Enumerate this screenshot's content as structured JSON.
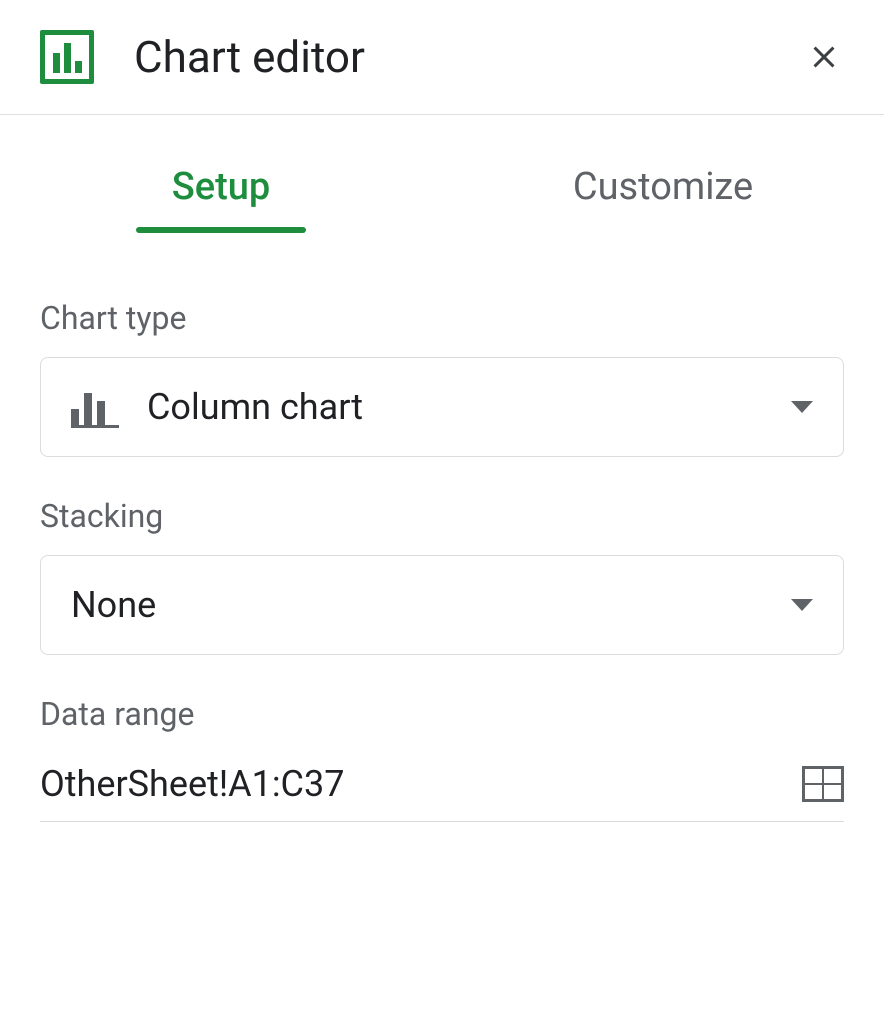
{
  "header": {
    "title": "Chart editor"
  },
  "tabs": {
    "setup": "Setup",
    "customize": "Customize"
  },
  "setup": {
    "chart_type_label": "Chart type",
    "chart_type_value": "Column chart",
    "stacking_label": "Stacking",
    "stacking_value": "None",
    "data_range_label": "Data range",
    "data_range_value": "OtherSheet!A1:C37"
  }
}
